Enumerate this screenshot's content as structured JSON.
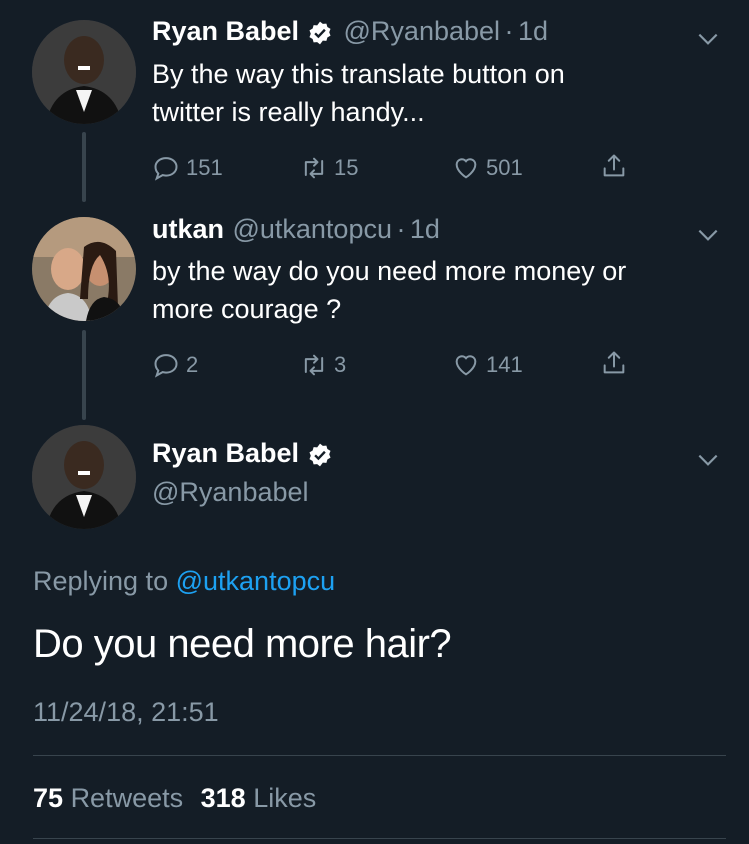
{
  "tweets": [
    {
      "name": "Ryan Babel",
      "handle": "@Ryanbabel",
      "sep": "·",
      "time": "1d",
      "text_line1": "By the way this translate button on",
      "text_line2": "twitter is really handy...",
      "replies": "151",
      "retweets": "15",
      "likes": "501"
    },
    {
      "name": "utkan",
      "handle": "@utkantopcu",
      "sep": "·",
      "time": "1d",
      "text_line1": "by the way do you need more money or",
      "text_line2": "more courage ?",
      "replies": "2",
      "retweets": "3",
      "likes": "141"
    }
  ],
  "main": {
    "name": "Ryan Babel",
    "handle": "@Ryanbabel",
    "replying_prefix": "Replying to",
    "replying_handle": "@utkantopcu",
    "text": "Do you need more hair?",
    "timestamp": "11/24/18, 21:51",
    "retweet_count": "75",
    "retweet_label": "Retweets",
    "like_count": "318",
    "like_label": "Likes"
  },
  "colors": {
    "background": "#141d26",
    "secondary_text": "#8899a6",
    "link": "#1da1f2",
    "divider": "#38444d"
  }
}
